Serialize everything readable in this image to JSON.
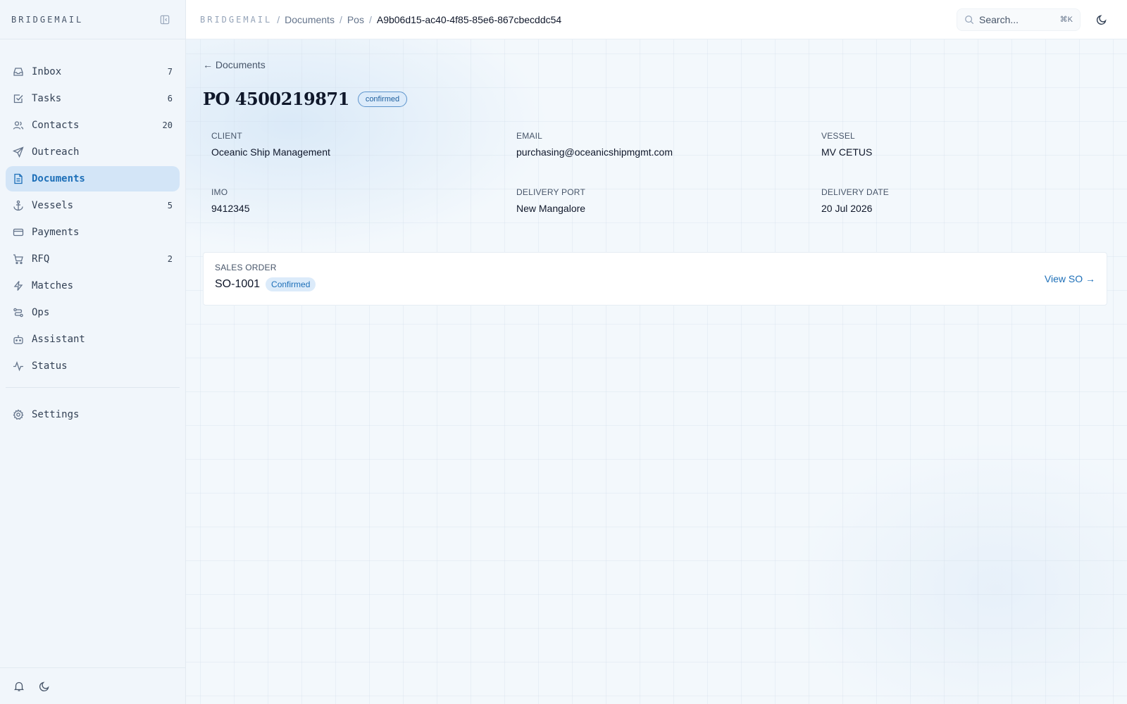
{
  "sidebar": {
    "brand": "BRIDGEMAIL",
    "items": [
      {
        "label": "Inbox",
        "count": "7",
        "icon": "inbox-icon"
      },
      {
        "label": "Tasks",
        "count": "6",
        "icon": "checkbox-icon"
      },
      {
        "label": "Contacts",
        "count": "20",
        "icon": "users-icon"
      },
      {
        "label": "Outreach",
        "count": "",
        "icon": "send-icon"
      },
      {
        "label": "Documents",
        "count": "",
        "icon": "document-icon",
        "active": true
      },
      {
        "label": "Vessels",
        "count": "5",
        "icon": "anchor-icon"
      },
      {
        "label": "Payments",
        "count": "",
        "icon": "credit-card-icon"
      },
      {
        "label": "RFQ",
        "count": "2",
        "icon": "cart-icon"
      },
      {
        "label": "Matches",
        "count": "",
        "icon": "lightning-icon"
      },
      {
        "label": "Ops",
        "count": "",
        "icon": "route-icon"
      },
      {
        "label": "Assistant",
        "count": "",
        "icon": "bot-icon"
      },
      {
        "label": "Status",
        "count": "",
        "icon": "activity-icon"
      }
    ],
    "settings_label": "Settings"
  },
  "header": {
    "brand": "BRIDGEMAIL",
    "crumbs": [
      "Documents",
      "Pos"
    ],
    "current": "A9b06d15-ac40-4f85-85e6-867cbecddc54",
    "search_placeholder": "Search...",
    "search_shortcut": "⌘K"
  },
  "main": {
    "back_label": "← Documents",
    "title": "PO 4500219871",
    "status": "confirmed",
    "fields": [
      {
        "label": "CLIENT",
        "value": "Oceanic Ship Management"
      },
      {
        "label": "EMAIL",
        "value": "purchasing@oceanicshipmgmt.com"
      },
      {
        "label": "VESSEL",
        "value": "MV CETUS"
      },
      {
        "label": "IMO",
        "value": "9412345"
      },
      {
        "label": "DELIVERY PORT",
        "value": "New Mangalore"
      },
      {
        "label": "DELIVERY DATE",
        "value": "20 Jul 2026"
      }
    ],
    "sales_order": {
      "label": "SALES ORDER",
      "number": "SO-1001",
      "status": "Confirmed",
      "link_label": "View SO →"
    }
  },
  "colors": {
    "accent": "#1d6fb8",
    "active_bg": "#d3e5f7",
    "badge_bg": "#dcebfa"
  }
}
